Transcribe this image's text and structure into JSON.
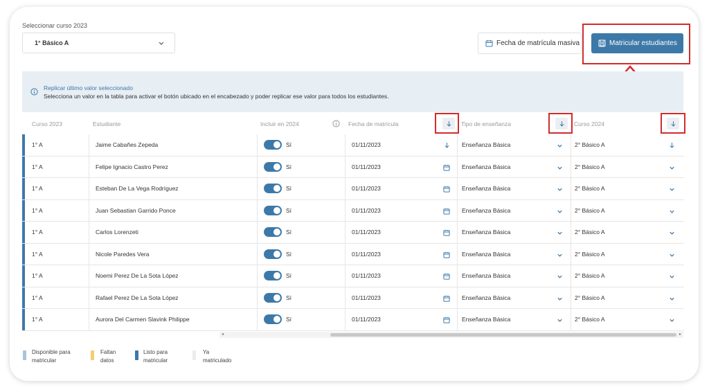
{
  "selector": {
    "label": "Seleccionar curso 2023",
    "value": "1° Básico A"
  },
  "buttons": {
    "fecha_masiva": "Fecha de matrícula masiva",
    "matricular": "Matricular estudiantes"
  },
  "info": {
    "title": "Replicar último valor seleccionado",
    "text": "Selecciona un valor en la tabla para activar el botón ubicado en el encabezado y poder replicar ese valor para todos los estudiantes."
  },
  "table": {
    "headers": {
      "curso": "Curso 2023",
      "estudiante": "Estudiante",
      "incluir": "Incluir en 2024",
      "fecha": "Fecha de matrícula",
      "tipo": "Tipo de enseñanza",
      "curso2024": "Curso 2024"
    },
    "rows": [
      {
        "curso": "1° A",
        "estudiante": "Jaime Cabañes Zepeda",
        "incluir": "Sí",
        "fecha": "01/11/2023",
        "tipo": "Enseñanza Básica",
        "curso2024": "2° Básico A"
      },
      {
        "curso": "1° A",
        "estudiante": "Felipe Ignacio Castro Perez",
        "incluir": "Sí",
        "fecha": "01/11/2023",
        "tipo": "Enseñanza Básica",
        "curso2024": "2° Básico A"
      },
      {
        "curso": "1° A",
        "estudiante": "Esteban De La Vega Rodríguez",
        "incluir": "Sí",
        "fecha": "01/11/2023",
        "tipo": "Enseñanza Básica",
        "curso2024": "2° Básico A"
      },
      {
        "curso": "1° A",
        "estudiante": "Juan Sebastian Garrido Ponce",
        "incluir": "Sí",
        "fecha": "01/11/2023",
        "tipo": "Enseñanza Básica",
        "curso2024": "2° Básico A"
      },
      {
        "curso": "1° A",
        "estudiante": "Carlos Lorenzeti",
        "incluir": "Sí",
        "fecha": "01/11/2023",
        "tipo": "Enseñanza Básica",
        "curso2024": "2° Básico A"
      },
      {
        "curso": "1° A",
        "estudiante": "Nicole Paredes Vera",
        "incluir": "Sí",
        "fecha": "01/11/2023",
        "tipo": "Enseñanza Básica",
        "curso2024": "2° Básico A"
      },
      {
        "curso": "1° A",
        "estudiante": "Noemi Perez De La Sota López",
        "incluir": "Sí",
        "fecha": "01/11/2023",
        "tipo": "Enseñanza Básica",
        "curso2024": "2° Básico A"
      },
      {
        "curso": "1° A",
        "estudiante": "Rafael Perez De La Sota López",
        "incluir": "Sí",
        "fecha": "01/11/2023",
        "tipo": "Enseñanza Básica",
        "curso2024": "2° Básico A"
      },
      {
        "curso": "1° A",
        "estudiante": "Aurora Del Carmen Slavink Philippe",
        "incluir": "Sí",
        "fecha": "01/11/2023",
        "tipo": "Enseñanza Básica",
        "curso2024": "2° Básico A"
      }
    ]
  },
  "legend": [
    {
      "line1": "Disponible para",
      "line2": "matricular",
      "color": "#a9c4d8"
    },
    {
      "line1": "Faltan",
      "line2": "datos",
      "color": "#f3cf6e"
    },
    {
      "line1": "Listo para",
      "line2": "matricular",
      "color": "#3d79a8"
    },
    {
      "line1": "Ya",
      "line2": "matriculado",
      "color": "#ececec"
    }
  ],
  "colors": {
    "primary": "#3d79a8",
    "highlight": "#d12b2b",
    "info_bg": "#e7eef4"
  }
}
